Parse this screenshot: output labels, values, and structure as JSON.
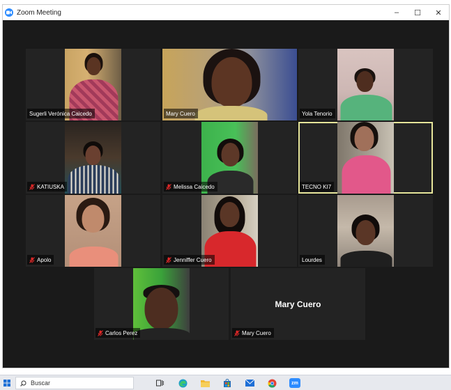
{
  "window": {
    "title": "Zoom Meeting",
    "minimize_symbol": "–",
    "maximize_symbol": "☐",
    "close_symbol": "✕"
  },
  "colors": {
    "active_speaker_border": "#e6e59a",
    "zoom_blue": "#2d8cff",
    "muted_red": "#e02828"
  },
  "participants": [
    {
      "name": "Sugerli Verónica Caicedo",
      "muted": false,
      "active": false
    },
    {
      "name": "Mary Cuero",
      "muted": false,
      "active": false
    },
    {
      "name": "Yola Tenorio",
      "muted": false,
      "active": false
    },
    {
      "name": "KATIUSKA",
      "muted": true,
      "active": false
    },
    {
      "name": "Melissa Caicedo",
      "muted": true,
      "active": false
    },
    {
      "name": "TECNO KI7",
      "muted": false,
      "active": true
    },
    {
      "name": "Apolo",
      "muted": true,
      "active": false
    },
    {
      "name": "Jenniffer Cuero",
      "muted": true,
      "active": false
    },
    {
      "name": "Lourdes",
      "muted": false,
      "active": false
    },
    {
      "name": "Carlos Perez",
      "muted": true,
      "active": false
    },
    {
      "name": "Mary Cuero",
      "muted": true,
      "active": false,
      "video_off": true,
      "display_name": "Mary Cuero"
    }
  ],
  "taskbar": {
    "search_placeholder": "Buscar",
    "apps": [
      "start-icon",
      "task-view-icon",
      "edge-icon",
      "file-explorer-icon",
      "store-icon",
      "mail-icon",
      "chrome-icon",
      "zoom-icon"
    ],
    "zoom_label": "zm"
  }
}
